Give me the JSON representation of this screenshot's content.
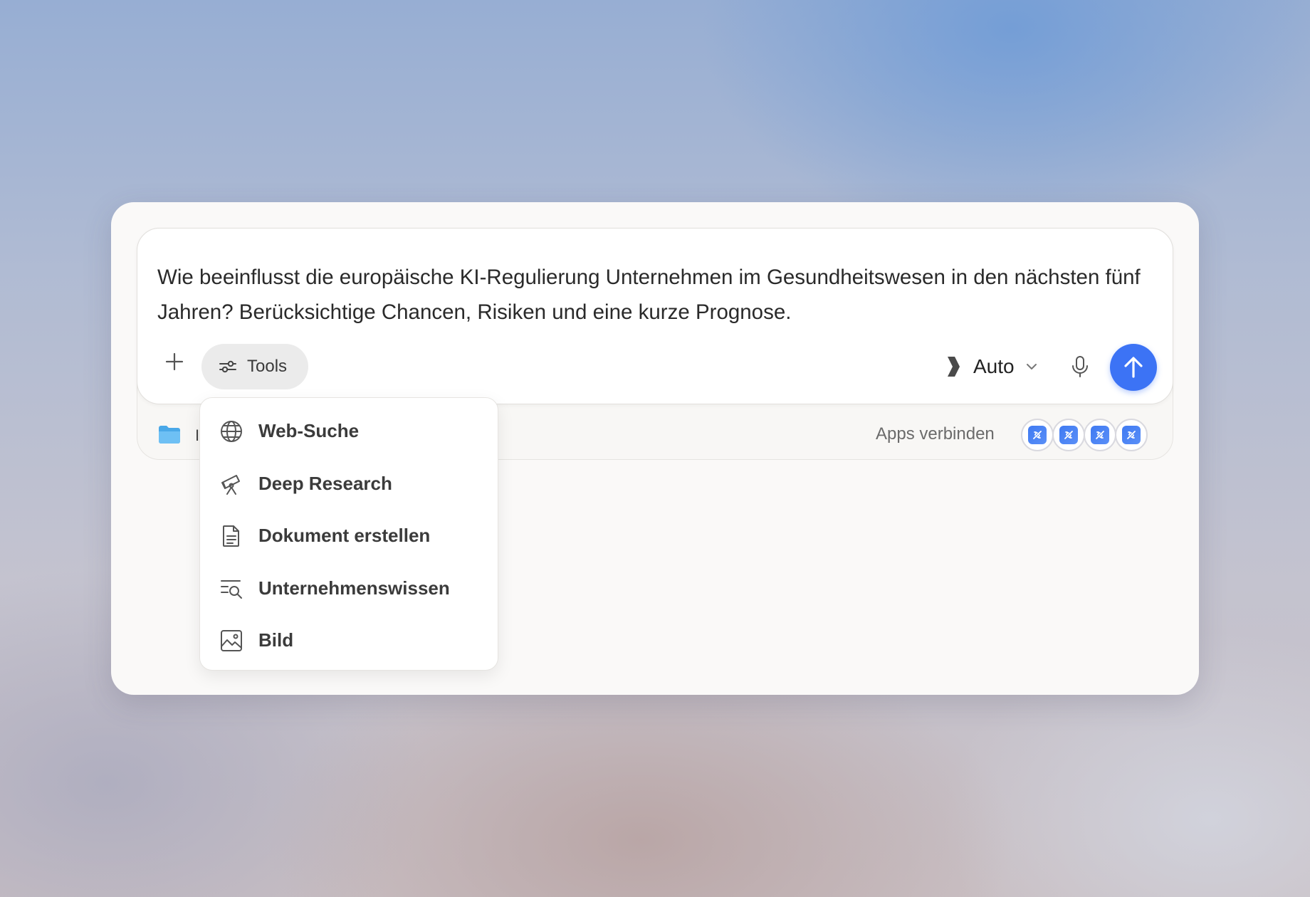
{
  "composer": {
    "prompt": "Wie beeinflusst die europäische KI-Regulierung Unternehmen im Gesundheitswesen in den nächsten fünf Jahren? Berücksichtige Chancen, Risiken und eine kurze Prognose.",
    "tools_label": "Tools",
    "model_label": "Auto"
  },
  "footer": {
    "folder_label": "I",
    "apps_label": "Apps verbinden"
  },
  "tools_menu": {
    "items": [
      {
        "label": "Web-Suche",
        "icon": "globe-icon"
      },
      {
        "label": "Deep Research",
        "icon": "telescope-icon"
      },
      {
        "label": "Dokument erstellen",
        "icon": "document-icon"
      },
      {
        "label": "Unternehmenswissen",
        "icon": "list-search-icon"
      },
      {
        "label": "Bild",
        "icon": "image-icon"
      }
    ]
  },
  "colors": {
    "accent": "#3c73f5",
    "card_bg": "#faf9f8"
  }
}
